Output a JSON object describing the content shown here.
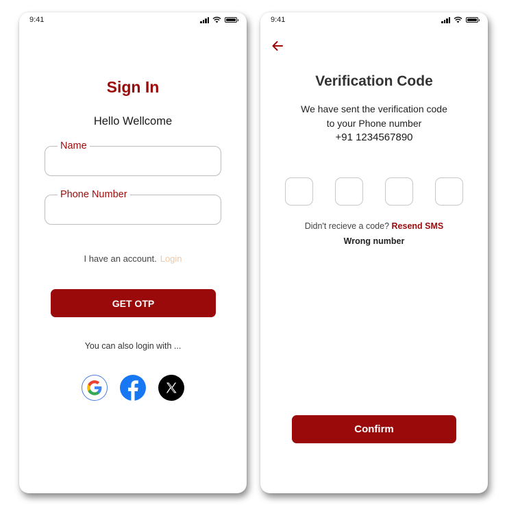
{
  "theme": {
    "brand_color": "#9b0a0a",
    "login_link_color": "#eec9a6"
  },
  "status_bar": {
    "time": "9:41"
  },
  "sign_in": {
    "title": "Sign In",
    "subtitle": "Hello Wellcome",
    "name_field": {
      "label": "Name",
      "value": ""
    },
    "phone_field": {
      "label": "Phone Number",
      "value": ""
    },
    "account_text": "I have an account.",
    "login_link": "Login",
    "get_otp_button": "GET OTP",
    "alt_login_text": "You can also login with ...",
    "social_icons": [
      "google-icon",
      "facebook-icon",
      "x-icon"
    ]
  },
  "verification": {
    "title": "Verification Code",
    "desc_line1": "We have sent the verification code",
    "desc_line2": "to your Phone number",
    "phone_number": "+91 1234567890",
    "otp_digits": [
      "",
      "",
      "",
      ""
    ],
    "resend_prompt": "Didn't recieve a code?",
    "resend_link": "Resend SMS",
    "wrong_number": "Wrong number",
    "confirm_button": "Confirm"
  }
}
